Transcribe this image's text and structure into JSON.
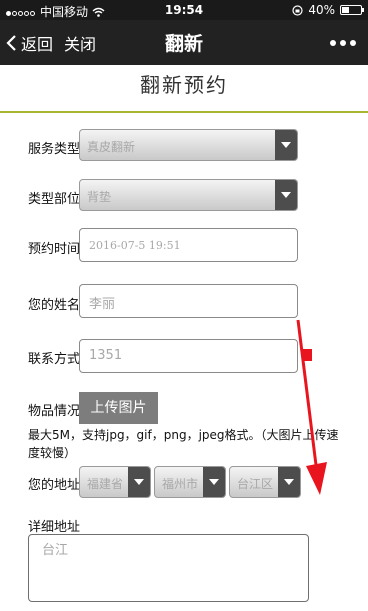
{
  "status_bar": {
    "carrier": "中国移动",
    "time": "19:54",
    "battery": "40%",
    "battery_level": 0.4
  },
  "nav": {
    "back_label": "返回",
    "close_label": "关闭",
    "title": "翻新"
  },
  "page": {
    "header": "翻新预约"
  },
  "form": {
    "service_type": {
      "label": "服务类型",
      "value": "真皮翻新"
    },
    "part": {
      "label": "类型部位",
      "value": "背垫"
    },
    "appointment_time": {
      "label": "预约时间",
      "value": "2016-07-5 19:51"
    },
    "name": {
      "label": "您的姓名",
      "value": "李丽"
    },
    "contact": {
      "label": "联系方式",
      "value": "1351"
    },
    "item_condition": {
      "label": "物品情况",
      "upload_label": "上传图片"
    },
    "upload_hint": "最大5M，支持jpg，gif，png，jpeg格式。（大图片上传速度较慢）",
    "address": {
      "label": "您的地址",
      "province": "福建省",
      "city": "福州市",
      "district": "台江区"
    },
    "detail_address": {
      "label": "详细地址",
      "value": "台江"
    }
  },
  "annotation_color": "#e8141e"
}
